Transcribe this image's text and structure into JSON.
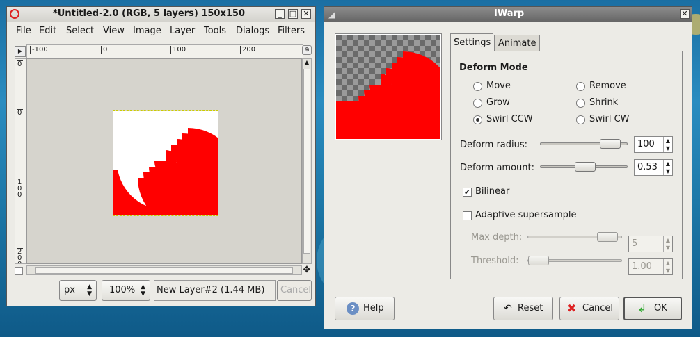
{
  "image_window": {
    "title": "*Untitled-2.0 (RGB, 5 layers) 150x150",
    "menu": [
      "File",
      "Edit",
      "Select",
      "View",
      "Image",
      "Layer",
      "Tools",
      "Dialogs",
      "Filters"
    ],
    "menu_mnemonics": [
      "F",
      "E",
      "S",
      "V",
      "I",
      "L",
      "T",
      "D",
      "F"
    ],
    "ruler_top_labels": [
      "-100",
      "0",
      "100",
      "200"
    ],
    "ruler_left_labels": [
      "0",
      "0",
      "100",
      "200"
    ],
    "status": {
      "unit": "px",
      "zoom": "100%",
      "layer_info": "New Layer#2 (1.44 MB)",
      "cancel_label": "Cancel"
    }
  },
  "iwarp_dialog": {
    "title": "IWarp",
    "tabs": [
      {
        "label": "Settings",
        "mnemonic": "S",
        "active": true
      },
      {
        "label": "Animate",
        "mnemonic": "A",
        "active": false
      }
    ],
    "section_title": "Deform Mode",
    "modes": [
      {
        "label": "Move",
        "selected": false
      },
      {
        "label": "Remove",
        "selected": false
      },
      {
        "label": "Grow",
        "selected": false
      },
      {
        "label": "Shrink",
        "selected": false
      },
      {
        "label": "Swirl CCW",
        "selected": true
      },
      {
        "label": "Swirl CW",
        "selected": false
      }
    ],
    "deform_radius": {
      "label": "Deform radius:",
      "value": "100",
      "fraction": 0.9
    },
    "deform_amount": {
      "label": "Deform amount:",
      "value": "0.53",
      "fraction": 0.52
    },
    "bilinear": {
      "label": "Bilinear",
      "checked": true
    },
    "adaptive": {
      "label": "Adaptive supersample",
      "checked": false
    },
    "max_depth": {
      "label": "Max depth:",
      "value": "5",
      "fraction": 0.95
    },
    "threshold": {
      "label": "Threshold:",
      "value": "1.00",
      "fraction": 0.0
    },
    "buttons": {
      "help": "Help",
      "reset": "Reset",
      "cancel": "Cancel",
      "ok": "OK"
    }
  },
  "colors": {
    "spiral_red": "#ff0000",
    "window_bg": "#ecebe6"
  }
}
